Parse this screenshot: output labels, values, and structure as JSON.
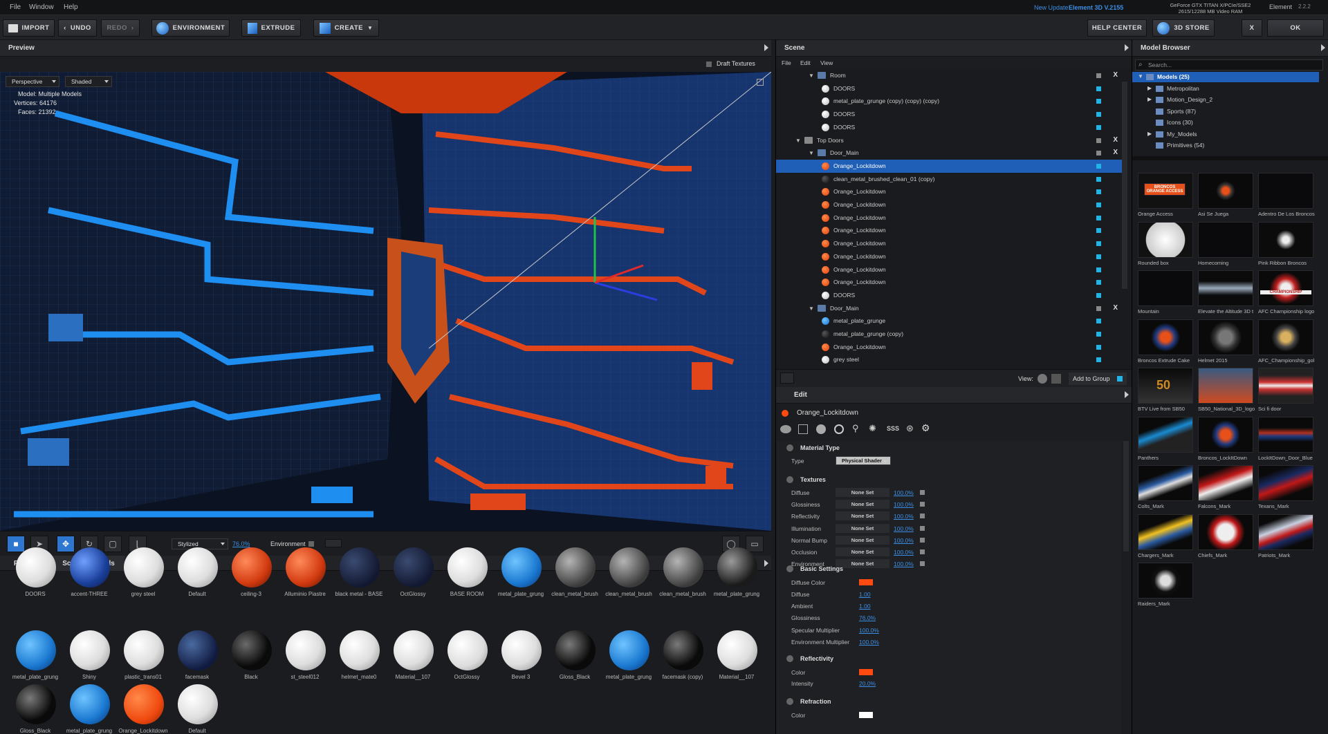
{
  "menu": [
    "File",
    "Window",
    "Help"
  ],
  "update_notice": {
    "prefix": "New Update:",
    "product": "Element 3D V.2155"
  },
  "gpu_info": {
    "line1": "GeForce GTX TITAN X/PCIe/SSE2",
    "line2": "2615/12288 MB Video RAM"
  },
  "app": {
    "name": "Element",
    "version": "2.2.2"
  },
  "toolbar": {
    "import": "IMPORT",
    "undo": "UNDO",
    "redo": "REDO",
    "environment": "ENVIRONMENT",
    "extrude": "EXTRUDE",
    "create": "CREATE",
    "help": "HELP CENTER",
    "store": "3D STORE",
    "close": "X",
    "ok": "OK"
  },
  "preview": {
    "title": "Preview",
    "draft_textures": "Draft Textures",
    "projection": "Perspective",
    "shading": "Shaded",
    "stats": {
      "model": "Model:  Multiple Models",
      "vertices": "Vertices:  64176",
      "faces": "Faces:  21392"
    }
  },
  "vpbar": {
    "render_mode": "Stylized",
    "quality": "76.0%",
    "environment": "Environment"
  },
  "materials_panel": {
    "tabs": [
      "Presets",
      "Scene Materials"
    ],
    "rows": [
      [
        "DOORS",
        "accent-THREE",
        "grey steel",
        "Default",
        "ceiling-3",
        "Alluminio Piastre",
        "black metal - BASE",
        "OctGlossy",
        "BASE ROOM",
        "metal_plate_grung",
        "clean_metal_brush",
        "clean_metal_brush",
        "clean_metal_brush",
        "metal_plate_grung"
      ],
      [
        "metal_plate_grung",
        "Shiny",
        "plastic_trans01",
        "facemask",
        "Black",
        "st_steel012",
        "helmet_mate0",
        "Material__107",
        "OctGlossy",
        "Bevel 3",
        "Gloss_Black",
        "metal_plate_grung",
        "facemask (copy)",
        "Material__107"
      ],
      [
        "Gloss_Black",
        "metal_plate_grung",
        "Orange_Lockitdown",
        "Default"
      ]
    ]
  },
  "scene": {
    "title": "Scene",
    "menu": [
      "File",
      "Edit",
      "View"
    ],
    "rows": [
      {
        "label": "Room",
        "kind": "group",
        "indent": 3,
        "x": true
      },
      {
        "label": "DOORS",
        "kind": "white",
        "indent": 4
      },
      {
        "label": "metal_plate_grunge (copy) (copy) (copy)",
        "kind": "white",
        "indent": 4
      },
      {
        "label": "DOORS",
        "kind": "white",
        "indent": 4
      },
      {
        "label": "DOORS",
        "kind": "white",
        "indent": 4
      },
      {
        "label": "Top Doors",
        "kind": "folder",
        "indent": 2,
        "x": true
      },
      {
        "label": "Door_Main",
        "kind": "group",
        "indent": 3,
        "x": true
      },
      {
        "label": "Orange_Lockitdown",
        "kind": "orange",
        "indent": 4,
        "selected": true
      },
      {
        "label": "clean_metal_brushed_clean_01 (copy)",
        "kind": "dark",
        "indent": 4
      },
      {
        "label": "Orange_Lockitdown",
        "kind": "orange",
        "indent": 4
      },
      {
        "label": "Orange_Lockitdown",
        "kind": "orange",
        "indent": 4
      },
      {
        "label": "Orange_Lockitdown",
        "kind": "orange",
        "indent": 4
      },
      {
        "label": "Orange_Lockitdown",
        "kind": "orange",
        "indent": 4
      },
      {
        "label": "Orange_Lockitdown",
        "kind": "orange",
        "indent": 4
      },
      {
        "label": "Orange_Lockitdown",
        "kind": "orange",
        "indent": 4
      },
      {
        "label": "Orange_Lockitdown",
        "kind": "orange",
        "indent": 4
      },
      {
        "label": "Orange_Lockitdown",
        "kind": "orange",
        "indent": 4
      },
      {
        "label": "DOORS",
        "kind": "white",
        "indent": 4
      },
      {
        "label": "Door_Main",
        "kind": "group",
        "indent": 3,
        "x": true
      },
      {
        "label": "metal_plate_grunge",
        "kind": "blue",
        "indent": 4
      },
      {
        "label": "metal_plate_grunge (copy)",
        "kind": "dark",
        "indent": 4
      },
      {
        "label": "Orange_Lockitdown",
        "kind": "orange",
        "indent": 4
      },
      {
        "label": "grey steel",
        "kind": "white",
        "indent": 4
      }
    ],
    "footer": {
      "view": "View:",
      "add_to_group": "Add to Group"
    }
  },
  "edit": {
    "title": "Edit",
    "selected": "Orange_Lockitdown",
    "material_type": {
      "section": "Material Type",
      "label": "Type",
      "value": "Physical Shader"
    },
    "textures": {
      "section": "Textures",
      "items": [
        {
          "label": "Diffuse",
          "value": "None Set",
          "pct": "100.0%"
        },
        {
          "label": "Glossiness",
          "value": "None Set",
          "pct": "100.0%"
        },
        {
          "label": "Reflectivity",
          "value": "None Set",
          "pct": "100.0%"
        },
        {
          "label": "Illumination",
          "value": "None Set",
          "pct": "100.0%"
        },
        {
          "label": "Normal Bump",
          "value": "None Set",
          "pct": "100.0%"
        },
        {
          "label": "Occlusion",
          "value": "None Set",
          "pct": "100.0%"
        },
        {
          "label": "Environment",
          "value": "None Set",
          "pct": "100.0%"
        }
      ]
    },
    "basic": {
      "section": "Basic Settings",
      "diffuse_color_label": "Diffuse Color",
      "diffuse_color": "#ff4a10",
      "items": [
        {
          "label": "Diffuse",
          "value": "1.00"
        },
        {
          "label": "Ambient",
          "value": "1.00"
        },
        {
          "label": "Glossiness",
          "value": "76.0%"
        },
        {
          "label": "Specular Multiplier",
          "value": "100.0%"
        },
        {
          "label": "Environment Multiplier",
          "value": "100.0%"
        }
      ]
    },
    "reflectivity": {
      "section": "Reflectivity",
      "color_label": "Color",
      "color": "#ff4a10",
      "intensity_label": "Intensity",
      "intensity": "20.0%"
    },
    "refraction": {
      "section": "Refraction",
      "color_label": "Color",
      "color": "#ffffff"
    }
  },
  "browser": {
    "title": "Model Browser",
    "search_placeholder": "Search...",
    "tree": [
      {
        "label": "Models (25)",
        "indent": 0,
        "selected": true,
        "open": true
      },
      {
        "label": "Metropolitan",
        "indent": 1,
        "arrow": true
      },
      {
        "label": "Motion_Design_2",
        "indent": 1,
        "arrow": true
      },
      {
        "label": "Sports (87)",
        "indent": 1
      },
      {
        "label": "Icons (30)",
        "indent": 1
      },
      {
        "label": "My_Models",
        "indent": 1,
        "arrow": true
      },
      {
        "label": "Primitives (54)",
        "indent": 1
      }
    ],
    "thumbs": [
      "Orange Access",
      "Asi Se Juega",
      "Adentro De Los Broncos",
      "Rounded box",
      "Homecoming",
      "Pink Ribbon Broncos",
      "Mountain",
      "Elevate the Altitude 3D t",
      "AFC Championship logo",
      "Broncos Extrude Cake",
      "Helmet 2015",
      "AFC_Championship_gol",
      "BTV Live from SB50",
      "SB50_National_3D_logo",
      "Sci fi door",
      "Panthers",
      "Broncos_LockItDown",
      "LockItDown_Door_Blue",
      "Colts_Mark",
      "Falcons_Mark",
      "Texans_Mark",
      "Chargers_Mark",
      "Chiefs_Mark",
      "Patriots_Mark",
      "Raiders_Mark"
    ],
    "thumb_texts": {
      "orange_access": "BRONCOS ORANGE ACCESS",
      "afc": "CHAMPIONSHIP",
      "sb50": "50"
    }
  },
  "colors": {
    "accent": "#2e77d0",
    "orange": "#ff4a10",
    "blue_link": "#3b8fe6",
    "check": "#21b4e8"
  }
}
